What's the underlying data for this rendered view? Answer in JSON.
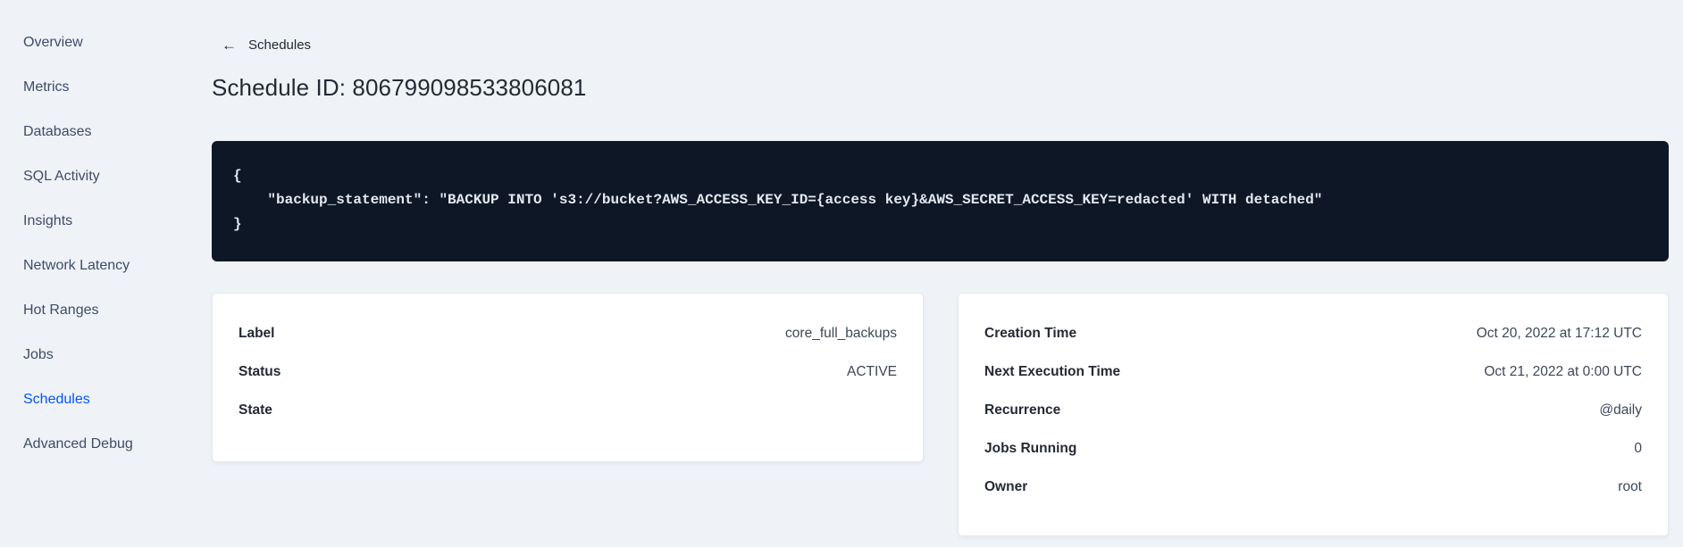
{
  "colors": {
    "background": "#eff3f8",
    "card_background": "#ffffff",
    "card_border": "#e4eaf1",
    "code_background": "#0e1726",
    "code_text": "#e4e8ef",
    "accent": "#0055ff",
    "text_primary": "#242a35",
    "text_secondary": "#3f4c66"
  },
  "sidebar": {
    "items": [
      {
        "label": "Overview",
        "active": false
      },
      {
        "label": "Metrics",
        "active": false
      },
      {
        "label": "Databases",
        "active": false
      },
      {
        "label": "SQL Activity",
        "active": false
      },
      {
        "label": "Insights",
        "active": false
      },
      {
        "label": "Network Latency",
        "active": false
      },
      {
        "label": "Hot Ranges",
        "active": false
      },
      {
        "label": "Jobs",
        "active": false
      },
      {
        "label": "Schedules",
        "active": true
      },
      {
        "label": "Advanced Debug",
        "active": false
      }
    ]
  },
  "header": {
    "back_icon": "arrow-left",
    "back_arrow_glyph": "←",
    "back_label": "Schedules",
    "title": "Schedule ID: 806799098533806081"
  },
  "schedule_definition": {
    "lines": [
      "{",
      "    \"backup_statement\": \"BACKUP INTO 's3://bucket?AWS_ACCESS_KEY_ID={access key}&AWS_SECRET_ACCESS_KEY=redacted' WITH detached\"",
      "}"
    ]
  },
  "details_left": {
    "rows": [
      {
        "label": "Label",
        "value": "core_full_backups"
      },
      {
        "label": "Status",
        "value": "ACTIVE"
      },
      {
        "label": "State",
        "value": ""
      }
    ]
  },
  "details_right": {
    "rows": [
      {
        "label": "Creation Time",
        "value": "Oct 20, 2022 at 17:12 UTC"
      },
      {
        "label": "Next Execution Time",
        "value": "Oct 21, 2022 at 0:00 UTC"
      },
      {
        "label": "Recurrence",
        "value": "@daily"
      },
      {
        "label": "Jobs Running",
        "value": "0"
      },
      {
        "label": "Owner",
        "value": "root"
      }
    ]
  }
}
